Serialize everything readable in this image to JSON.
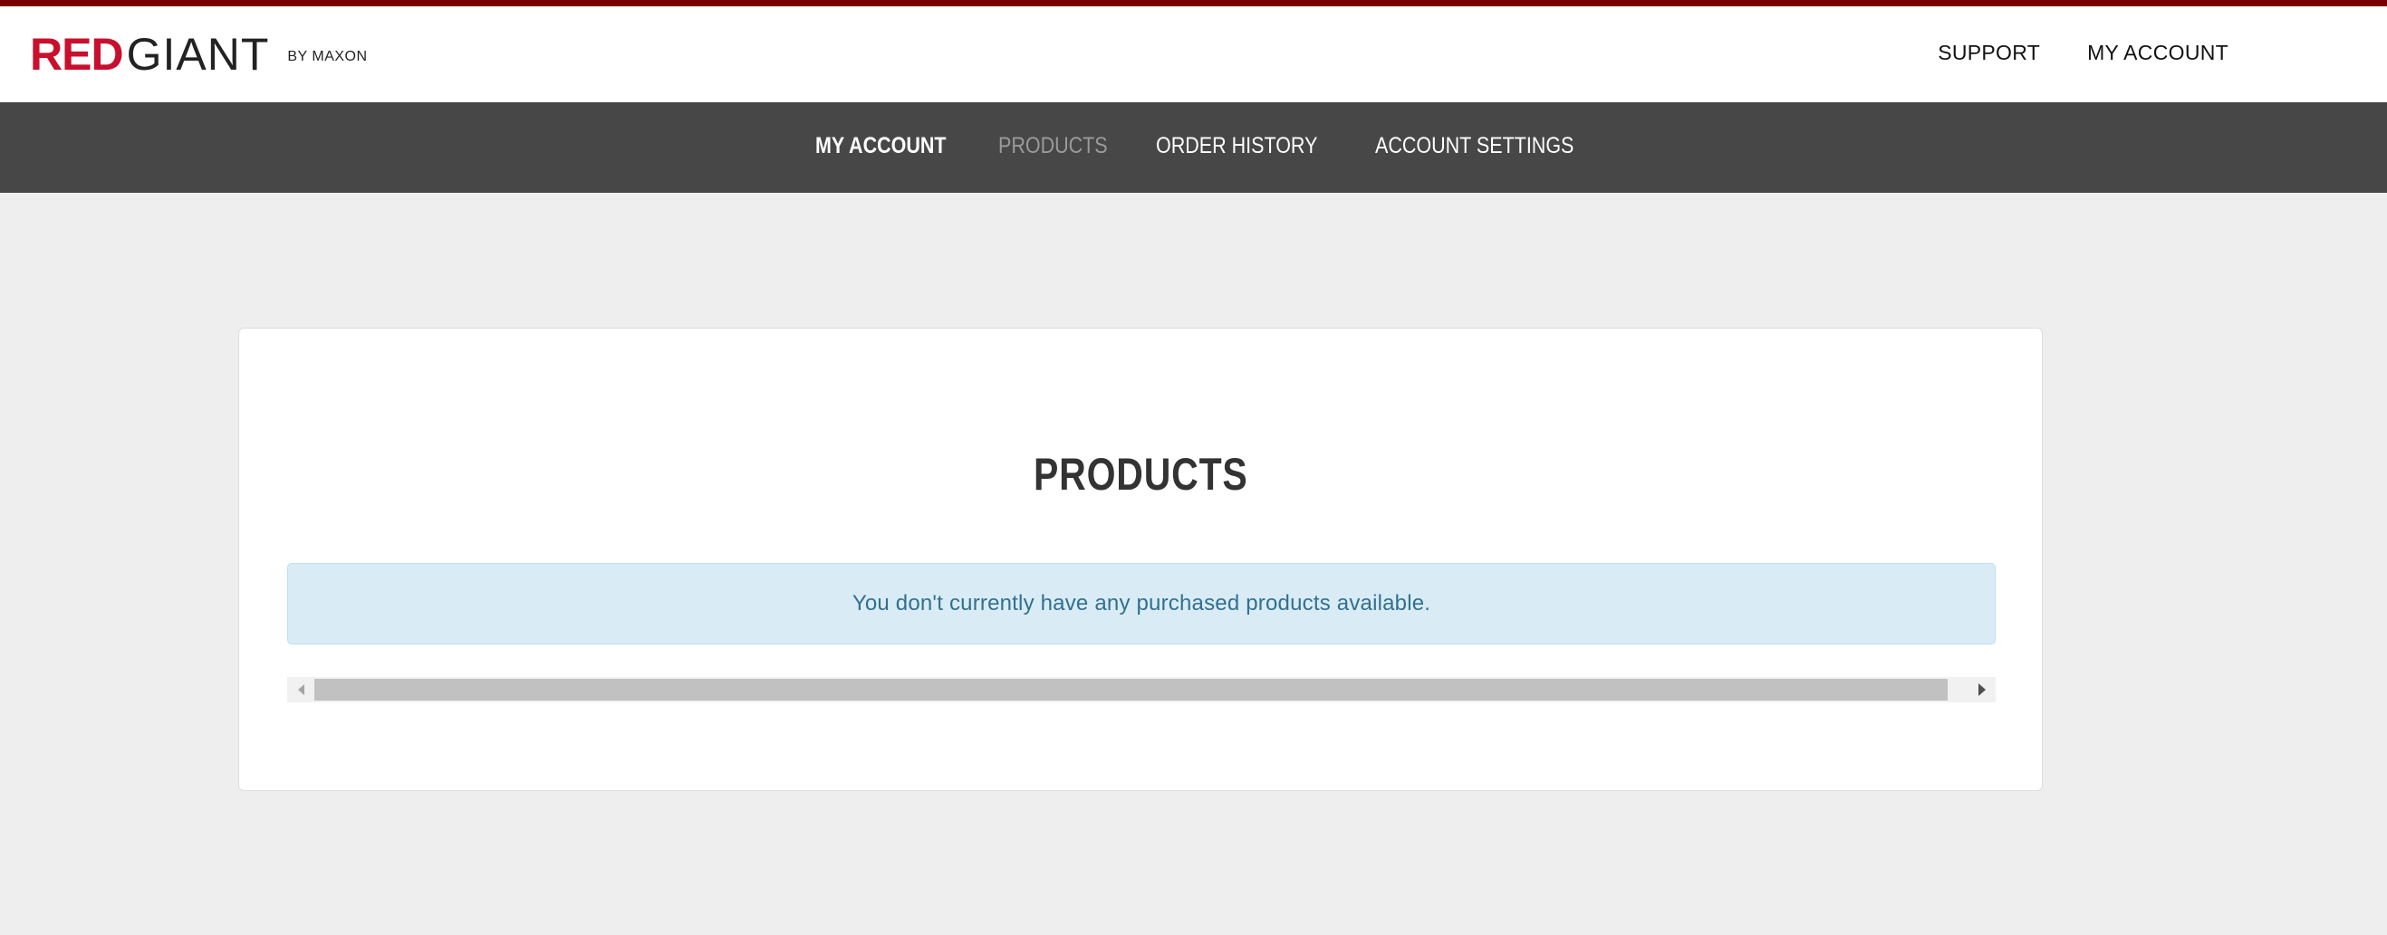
{
  "brand": {
    "red": "RED",
    "giant": "GIANT",
    "by": "BY MAXON",
    "colors": {
      "red": "#c8102e",
      "top_strip": "#7a0000"
    }
  },
  "header_links": [
    {
      "label": "SUPPORT"
    },
    {
      "label": "MY ACCOUNT"
    }
  ],
  "subnav": {
    "items": [
      {
        "label": "MY ACCOUNT",
        "state": "active"
      },
      {
        "label": "PRODUCTS",
        "state": "current"
      },
      {
        "label": "ORDER HISTORY",
        "state": "normal"
      },
      {
        "label": "ACCOUNT SETTINGS",
        "state": "normal"
      }
    ],
    "background": "#474747"
  },
  "main": {
    "title": "PRODUCTS",
    "alert": "You don't currently have any purchased products available.",
    "scrollbar": {
      "left_icon": "scroll-left-arrow-icon",
      "right_icon": "scroll-right-arrow-icon"
    }
  }
}
